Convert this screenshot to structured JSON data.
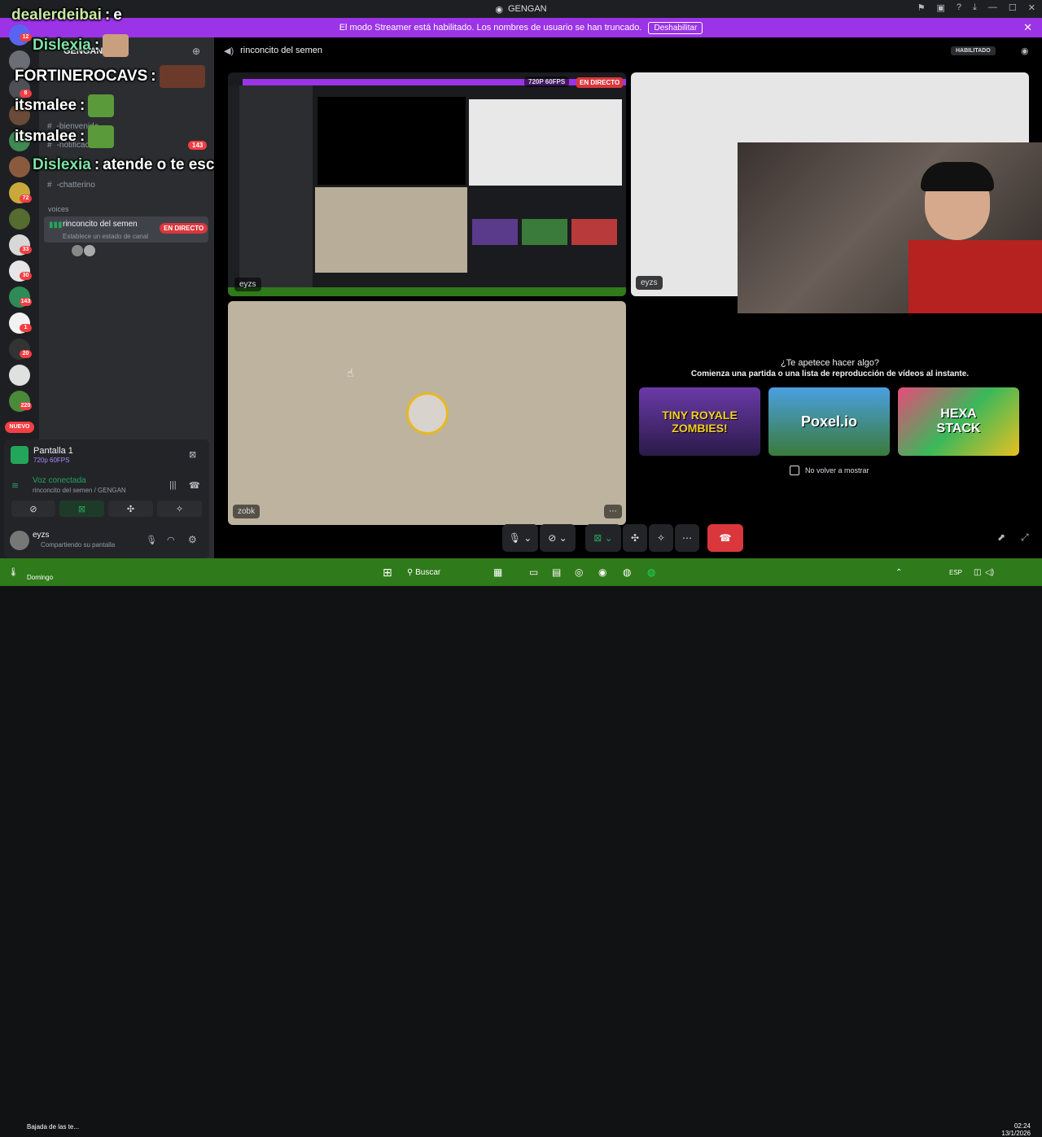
{
  "window": {
    "title": "GENGAN"
  },
  "banner": {
    "text": "El modo Streamer está habilitado. Los nombres de usuario se han truncado.",
    "button": "Deshabilitar"
  },
  "guild_badges": [
    "12",
    "8",
    "72",
    "33",
    "30",
    "143",
    "1",
    "20",
    "220"
  ],
  "nuevo": "NUEVO",
  "server": {
    "name": "GENGAN"
  },
  "channels": [
    {
      "label": "-bienvenida"
    },
    {
      "label": "-notificaciones",
      "badge": "143"
    },
    {
      "label": "-chatterino"
    }
  ],
  "voice_category": "voices",
  "voice_channel": {
    "name": "rinconcito del semen",
    "status": "Establece un estado de canal",
    "live": "EN DIRECTO"
  },
  "overlay_chat": [
    {
      "user": "dealerdeibai",
      "text": "e"
    },
    {
      "user": "Dislexia",
      "text": ""
    },
    {
      "user": "FORTINEROCAVS",
      "text": ""
    },
    {
      "user": "itsmalee",
      "text": ""
    },
    {
      "user": "itsmalee",
      "text": ""
    },
    {
      "user": "Dislexia",
      "text": "atende o te escracho en tiktok"
    }
  ],
  "stream_panel": {
    "title": "Pantalla 1",
    "quality": "720p 60FPS"
  },
  "voice_connected": {
    "status": "Voz conectada",
    "location": "rinconcito del semen / GENGAN"
  },
  "user": {
    "name": "eyzs",
    "status": "Compartiendo su pantalla"
  },
  "header": {
    "channel": "rinconcito del semen",
    "badge": "HABILITADO"
  },
  "stream_tile": {
    "quality": "720P 60FPS",
    "live": "EN DIRECTO",
    "user": "eyzs"
  },
  "zobk_tile": {
    "user": "zobk"
  },
  "eyzs_tile": {
    "user": "eyzs"
  },
  "activity": {
    "title": "¿Te apetece hacer algo?",
    "subtitle": "Comienza una partida o una lista de reproducción de vídeos al instante.",
    "games": [
      "TINY ROYALE ZOMBIES!",
      "Poxel.io",
      "HEXA STACK"
    ],
    "dont_show": "No volver a mostrar"
  },
  "taskbar": {
    "weather": "Bajada de las te...",
    "weather_sub": "Domingo",
    "search": "Buscar",
    "lang": "ESP",
    "time": "02:24",
    "date": "13/1/2026"
  }
}
